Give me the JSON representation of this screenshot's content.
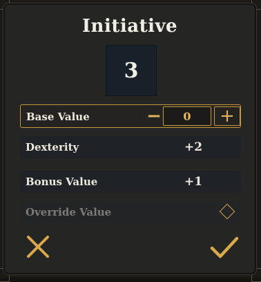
{
  "dialog": {
    "title": "Initiative",
    "total": "3"
  },
  "rows": {
    "base": {
      "label": "Base Value",
      "value": "0"
    },
    "dexterity": {
      "label": "Dexterity",
      "value": "+2"
    },
    "bonus": {
      "label": "Bonus Value",
      "value": "+1"
    },
    "override": {
      "label": "Override Value"
    }
  },
  "icons": {
    "minus": "minus-icon",
    "plus": "plus-icon",
    "diamond": "diamond-toggle-icon",
    "cancel": "close-icon",
    "confirm": "check-icon"
  },
  "colors": {
    "accent": "#c89a3c",
    "panel": "#252624",
    "text": "#ece8dd",
    "muted": "#7d7b76"
  }
}
